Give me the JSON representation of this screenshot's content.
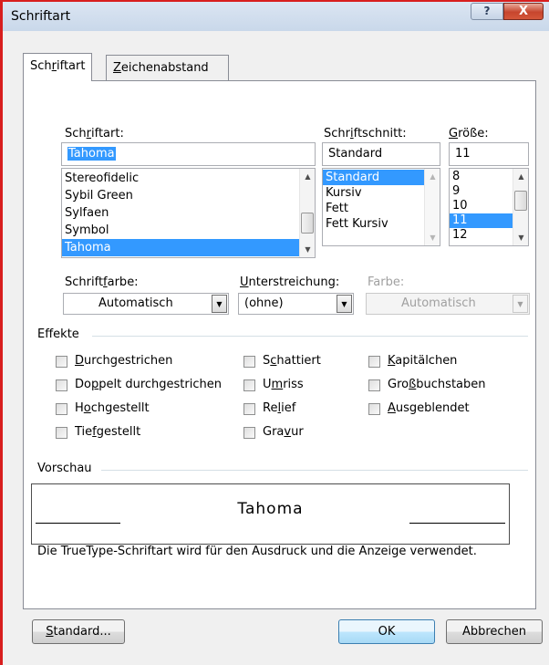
{
  "window": {
    "title": "Schriftart",
    "help_label": "?",
    "close_label": "X"
  },
  "tabs": [
    {
      "label_pre": "Sch",
      "label_u": "r",
      "label_post": "iftart"
    },
    {
      "label_pre": "",
      "label_u": "Z",
      "label_post": "eichenabstand"
    }
  ],
  "font": {
    "label_pre": "Sch",
    "label_u": "r",
    "label_post": "iftart:",
    "value": "Tahoma",
    "items": [
      "Stereofidelic",
      "Sybil Green",
      "Sylfaen",
      "Symbol",
      "Tahoma"
    ]
  },
  "style": {
    "label_pre": "Schr",
    "label_u": "i",
    "label_post": "ftschnitt:",
    "value": "Standard",
    "items": [
      "Standard",
      "Kursiv",
      "Fett",
      "Fett Kursiv"
    ]
  },
  "size": {
    "label_pre": "",
    "label_u": "G",
    "label_post": "röße:",
    "value": "11",
    "items": [
      "8",
      "9",
      "10",
      "11",
      "12"
    ]
  },
  "font_color": {
    "label_pre": "Schrift",
    "label_u": "f",
    "label_post": "arbe:",
    "value": "Automatisch"
  },
  "underline": {
    "label_pre": "",
    "label_u": "U",
    "label_post": "nterstreichung:",
    "value": "(ohne)"
  },
  "underline_color": {
    "label": "Farbe:",
    "value": "Automatisch"
  },
  "effects": {
    "title": "Effekte",
    "col1": [
      {
        "pre": "",
        "u": "D",
        "post": "urchgestrichen"
      },
      {
        "pre": "Do",
        "u": "p",
        "post": "pelt durchgestrichen"
      },
      {
        "pre": "H",
        "u": "o",
        "post": "chgestellt"
      },
      {
        "pre": "Tie",
        "u": "f",
        "post": "gestellt"
      }
    ],
    "col2": [
      {
        "pre": "S",
        "u": "c",
        "post": "hattiert"
      },
      {
        "pre": "U",
        "u": "m",
        "post": "riss"
      },
      {
        "pre": "Re",
        "u": "l",
        "post": "ief"
      },
      {
        "pre": "Gra",
        "u": "v",
        "post": "ur"
      }
    ],
    "col3": [
      {
        "pre": "",
        "u": "K",
        "post": "apitälchen"
      },
      {
        "pre": "Gro",
        "u": "ß",
        "post": "buchstaben"
      },
      {
        "pre": "",
        "u": "A",
        "post": "usgeblendet"
      }
    ]
  },
  "preview": {
    "title": "Vorschau",
    "sample": "Tahoma",
    "note": "Die TrueType-Schriftart wird für den Ausdruck und die Anzeige verwendet."
  },
  "buttons": {
    "standard_pre": "",
    "standard_u": "S",
    "standard_post": "tandard...",
    "ok": "OK",
    "cancel": "Abbrechen"
  },
  "colors": {
    "selection": "#3399ff",
    "frame_accent": "#d81e1e",
    "titlebar": "#c9d8ea"
  },
  "icons": [
    "help-icon",
    "close-icon",
    "scroll-up-icon",
    "scroll-down-icon",
    "dropdown-arrow-icon"
  ]
}
